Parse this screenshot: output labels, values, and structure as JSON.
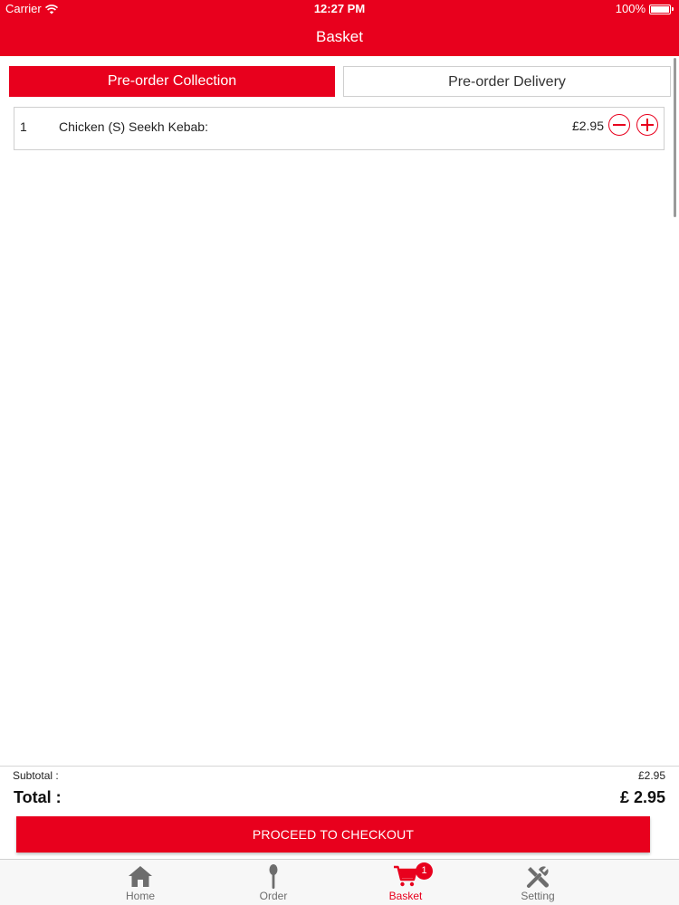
{
  "status_bar": {
    "carrier": "Carrier",
    "time": "12:27 PM",
    "battery": "100%"
  },
  "header": {
    "title": "Basket"
  },
  "tabs": [
    {
      "label": "Pre-order Collection",
      "active": true
    },
    {
      "label": "Pre-order Delivery",
      "active": false
    }
  ],
  "basket": {
    "items": [
      {
        "qty": "1",
        "name": "Chicken (S) Seekh Kebab:",
        "price": "£2.95"
      }
    ]
  },
  "totals": {
    "subtotal_label": "Subtotal :",
    "subtotal_value": "£2.95",
    "total_label": "Total :",
    "total_value": "£ 2.95"
  },
  "checkout": {
    "label": "PROCEED TO CHECKOUT"
  },
  "tabbar": {
    "items": [
      {
        "label": "Home",
        "icon": "home-icon"
      },
      {
        "label": "Order",
        "icon": "spoon-icon"
      },
      {
        "label": "Basket",
        "icon": "cart-icon",
        "badge": "1",
        "active": true
      },
      {
        "label": "Setting",
        "icon": "tools-icon"
      }
    ]
  },
  "colors": {
    "accent": "#e8001d",
    "tab_inactive": "#6d6d6d"
  }
}
